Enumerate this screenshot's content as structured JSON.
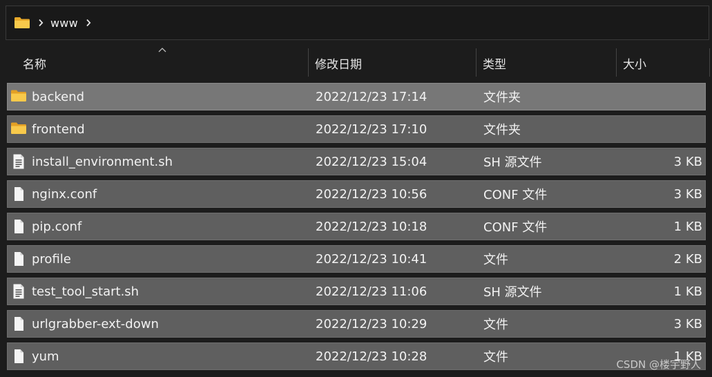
{
  "breadcrumb": {
    "icon": "folder-icon",
    "items": [
      "www"
    ]
  },
  "columns": {
    "name": "名称",
    "modified": "修改日期",
    "type": "类型",
    "size": "大小",
    "sorted_by": "name"
  },
  "files": [
    {
      "name": "backend",
      "modified": "2022/12/23 17:14",
      "type": "文件夹",
      "size": "",
      "icon": "folder-icon",
      "selected": true
    },
    {
      "name": "frontend",
      "modified": "2022/12/23 17:10",
      "type": "文件夹",
      "size": "",
      "icon": "folder-icon",
      "selected": false
    },
    {
      "name": "install_environment.sh",
      "modified": "2022/12/23 15:04",
      "type": "SH 源文件",
      "size": "3 KB",
      "icon": "script-file-icon",
      "selected": false
    },
    {
      "name": "nginx.conf",
      "modified": "2022/12/23 10:56",
      "type": "CONF 文件",
      "size": "3 KB",
      "icon": "file-icon",
      "selected": false
    },
    {
      "name": "pip.conf",
      "modified": "2022/12/23 10:18",
      "type": "CONF 文件",
      "size": "1 KB",
      "icon": "file-icon",
      "selected": false
    },
    {
      "name": "profile",
      "modified": "2022/12/23 10:41",
      "type": "文件",
      "size": "2 KB",
      "icon": "file-icon",
      "selected": false
    },
    {
      "name": "test_tool_start.sh",
      "modified": "2022/12/23 11:06",
      "type": "SH 源文件",
      "size": "1 KB",
      "icon": "script-file-icon",
      "selected": false
    },
    {
      "name": "urlgrabber-ext-down",
      "modified": "2022/12/23 10:29",
      "type": "文件",
      "size": "3 KB",
      "icon": "file-icon",
      "selected": false
    },
    {
      "name": "yum",
      "modified": "2022/12/23 10:28",
      "type": "文件",
      "size": "1 KB",
      "icon": "file-icon",
      "selected": false
    }
  ],
  "watermark": "CSDN @楼宇野人",
  "colors": {
    "background": "#1c1c1c",
    "row": "#5f5f5f",
    "row_selected": "#777777",
    "folder_yellow": "#f6c343"
  }
}
